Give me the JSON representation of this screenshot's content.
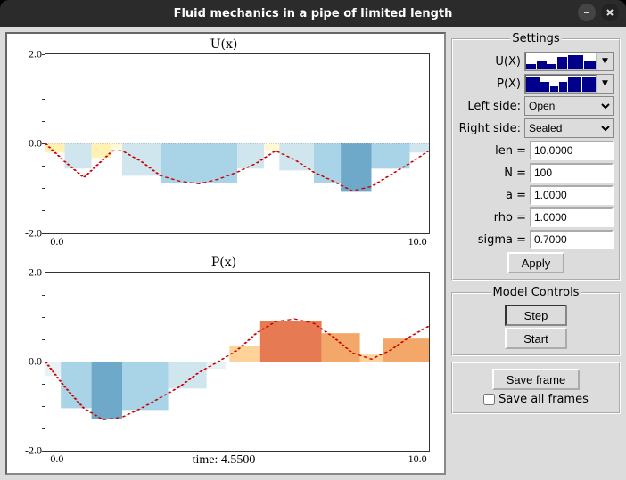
{
  "window": {
    "title": "Fluid mechanics in a pipe of limited length"
  },
  "settings": {
    "legend": "Settings",
    "ux_label": "U(X)",
    "px_label": "P(X)",
    "left_label": "Left side:",
    "left_value": "Open",
    "right_label": "Right side:",
    "right_value": "Sealed",
    "len_label": "len =",
    "len_value": "10.0000",
    "n_label": "N =",
    "n_value": "100",
    "a_label": "a =",
    "a_value": "1.0000",
    "rho_label": "rho =",
    "rho_value": "1.0000",
    "sigma_label": "sigma =",
    "sigma_value": "0.7000",
    "apply_label": "Apply"
  },
  "model": {
    "legend": "Model Controls",
    "step_label": "Step",
    "start_label": "Start"
  },
  "save": {
    "save_frame_label": "Save frame",
    "save_all_label": "Save all frames"
  },
  "chart_data": [
    {
      "type": "area",
      "title": "U(x)",
      "xlabel": "",
      "ylabel": "",
      "xlim": [
        0,
        10
      ],
      "ylim": [
        -2,
        2
      ],
      "x_ticks": [
        "0.0",
        "10.0"
      ],
      "y_ticks": [
        "-2.0",
        "0.0",
        "2.0"
      ],
      "series": [
        {
          "name": "U",
          "x": [
            0.0,
            0.5,
            1.0,
            1.5,
            2.0,
            2.5,
            3.0,
            3.5,
            4.0,
            4.5,
            5.0,
            5.5,
            6.0,
            6.5,
            7.0,
            7.5,
            8.0,
            8.5,
            9.0,
            9.5,
            10.0
          ],
          "values": [
            0.0,
            -0.4,
            -0.75,
            -0.35,
            -0.15,
            -0.4,
            -0.72,
            -0.85,
            -0.9,
            -0.8,
            -0.65,
            -0.45,
            -0.15,
            -0.35,
            -0.65,
            -0.85,
            -1.05,
            -0.95,
            -0.7,
            -0.45,
            -0.15
          ]
        }
      ]
    },
    {
      "type": "area",
      "title": "P(x)",
      "xlabel": "time: 4.5500",
      "ylabel": "",
      "xlim": [
        0,
        10
      ],
      "ylim": [
        -2,
        2
      ],
      "x_ticks": [
        "0.0",
        "10.0"
      ],
      "y_ticks": [
        "-2.0",
        "0.0",
        "2.0"
      ],
      "series": [
        {
          "name": "P",
          "x": [
            0.0,
            0.5,
            1.0,
            1.5,
            2.0,
            2.5,
            3.0,
            3.5,
            4.0,
            4.5,
            5.0,
            5.5,
            6.0,
            6.5,
            7.0,
            7.5,
            8.0,
            8.5,
            9.0,
            9.5,
            10.0
          ],
          "values": [
            0.0,
            -0.55,
            -1.05,
            -1.3,
            -1.25,
            -1.05,
            -0.8,
            -0.55,
            -0.25,
            0.0,
            0.25,
            0.65,
            0.9,
            0.95,
            0.85,
            0.55,
            0.2,
            0.05,
            0.25,
            0.55,
            0.8
          ]
        }
      ]
    }
  ]
}
